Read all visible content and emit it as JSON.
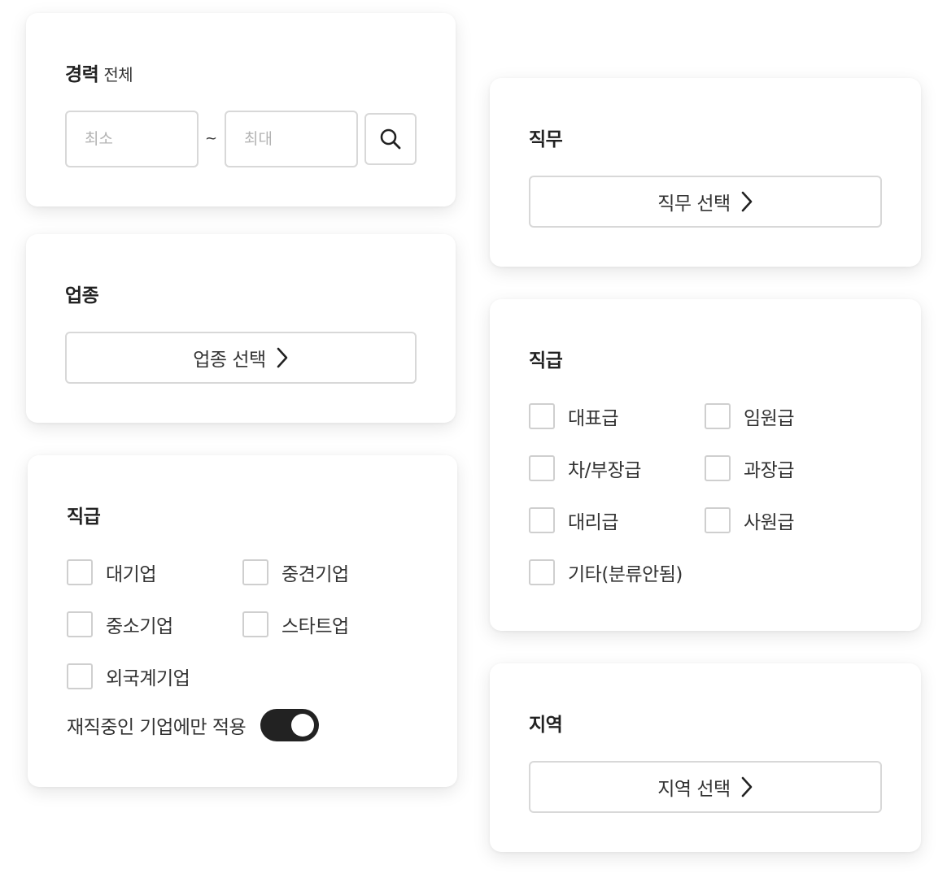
{
  "career": {
    "title": "경력",
    "subtitle": "전체",
    "min_placeholder": "최소",
    "separator": "~",
    "max_placeholder": "최대",
    "search_icon": "search-icon"
  },
  "industry": {
    "title": "업종",
    "button_label": "업종 선택"
  },
  "company": {
    "title": "직급",
    "options": [
      "대기업",
      "중견기업",
      "중소기업",
      "스타트업",
      "외국계기업"
    ],
    "toggle_label": "재직중인 기업에만 적용",
    "toggle_on": true
  },
  "job": {
    "title": "직무",
    "button_label": "직무 선택"
  },
  "position": {
    "title": "직급",
    "options": [
      "대표급",
      "임원급",
      "차/부장급",
      "과장급",
      "대리급",
      "사원급",
      "기타(분류안됨)"
    ]
  },
  "region": {
    "title": "지역",
    "button_label": "지역 선택"
  },
  "colors": {
    "toggle_active": "#222222",
    "border": "#d8d8d8",
    "card_bg": "#ffffff"
  }
}
